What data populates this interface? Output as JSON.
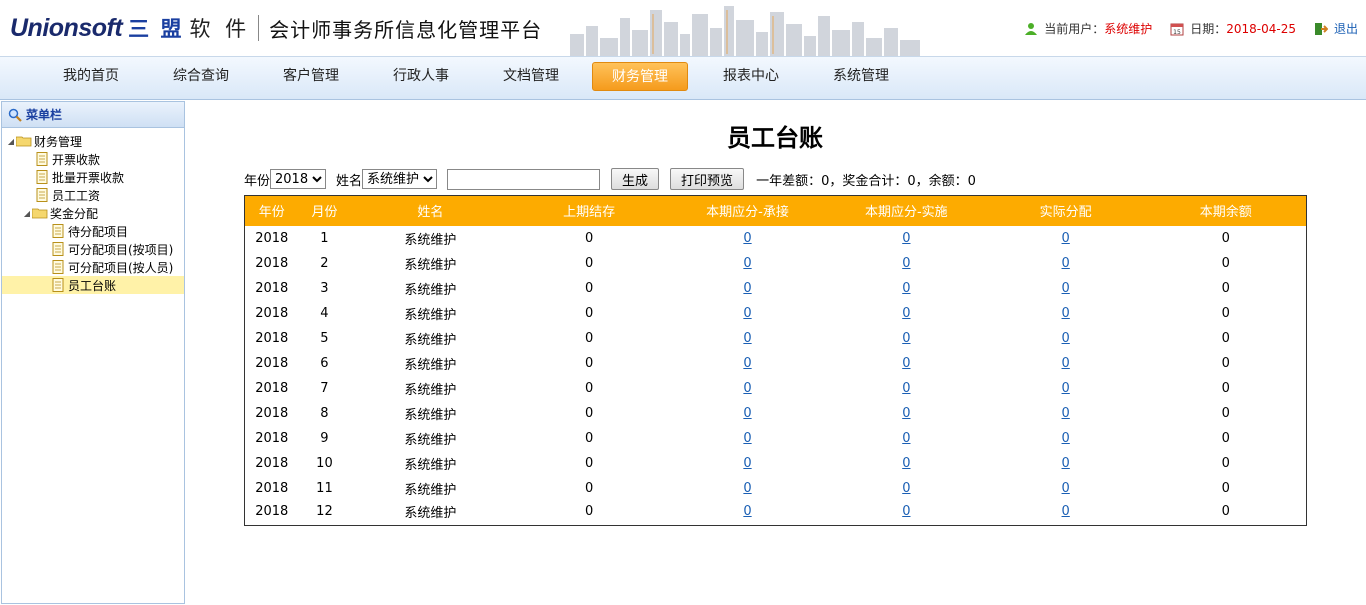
{
  "header": {
    "brand": "Unionsoft",
    "brand_cn": "三 盟",
    "brand_cn2": "软 件",
    "platform_title": "会计师事务所信息化管理平台",
    "current_user_label": "当前用户：",
    "current_user": "系统维护",
    "date_label": "日期：",
    "date": "2018-04-25",
    "logout": "退出"
  },
  "nav": {
    "items": [
      "我的首页",
      "综合查询",
      "客户管理",
      "行政人事",
      "文档管理",
      "财务管理",
      "报表中心",
      "系统管理"
    ],
    "active": "财务管理"
  },
  "sidebar": {
    "title": "菜单栏",
    "tree": [
      {
        "label": "财务管理",
        "type": "folder",
        "level": 0
      },
      {
        "label": "开票收款",
        "type": "doc",
        "level": 1
      },
      {
        "label": "批量开票收款",
        "type": "doc",
        "level": 1
      },
      {
        "label": "员工工资",
        "type": "doc",
        "level": 1
      },
      {
        "label": "奖金分配",
        "type": "folder",
        "level": 1
      },
      {
        "label": "待分配项目",
        "type": "doc",
        "level": 2
      },
      {
        "label": "可分配项目(按项目)",
        "type": "doc",
        "level": 2
      },
      {
        "label": "可分配项目(按人员)",
        "type": "doc",
        "level": 2
      },
      {
        "label": "员工台账",
        "type": "doc",
        "level": 2,
        "selected": true
      }
    ]
  },
  "main": {
    "title": "员工台账",
    "filter": {
      "year_label": "年份",
      "year_value": "2018",
      "name_label": "姓名",
      "name_value": "系统维护",
      "text_value": "",
      "generate_button": "生成",
      "print_button": "打印预览",
      "summary": "一年差额：0，奖金合计：0，余额：0"
    },
    "table": {
      "headers": [
        "年份",
        "月份",
        "姓名",
        "上期结存",
        "本期应分-承接",
        "本期应分-实施",
        "实际分配",
        "本期余额"
      ],
      "rows": [
        [
          "2018",
          "1",
          "系统维护",
          "0",
          "0",
          "0",
          "0",
          "0"
        ],
        [
          "2018",
          "2",
          "系统维护",
          "0",
          "0",
          "0",
          "0",
          "0"
        ],
        [
          "2018",
          "3",
          "系统维护",
          "0",
          "0",
          "0",
          "0",
          "0"
        ],
        [
          "2018",
          "4",
          "系统维护",
          "0",
          "0",
          "0",
          "0",
          "0"
        ],
        [
          "2018",
          "5",
          "系统维护",
          "0",
          "0",
          "0",
          "0",
          "0"
        ],
        [
          "2018",
          "6",
          "系统维护",
          "0",
          "0",
          "0",
          "0",
          "0"
        ],
        [
          "2018",
          "7",
          "系统维护",
          "0",
          "0",
          "0",
          "0",
          "0"
        ],
        [
          "2018",
          "8",
          "系统维护",
          "0",
          "0",
          "0",
          "0",
          "0"
        ],
        [
          "2018",
          "9",
          "系统维护",
          "0",
          "0",
          "0",
          "0",
          "0"
        ],
        [
          "2018",
          "10",
          "系统维护",
          "0",
          "0",
          "0",
          "0",
          "0"
        ],
        [
          "2018",
          "11",
          "系统维护",
          "0",
          "0",
          "0",
          "0",
          "0"
        ],
        [
          "2018",
          "12",
          "系统维护",
          "0",
          "0",
          "0",
          "0",
          "0"
        ]
      ],
      "link_columns": [
        4,
        5,
        6
      ]
    }
  },
  "colors": {
    "table_header": "#fdab00",
    "nav_active": "#f59b1c",
    "link": "#1a5fb4",
    "highlight_red": "#dd0000"
  }
}
